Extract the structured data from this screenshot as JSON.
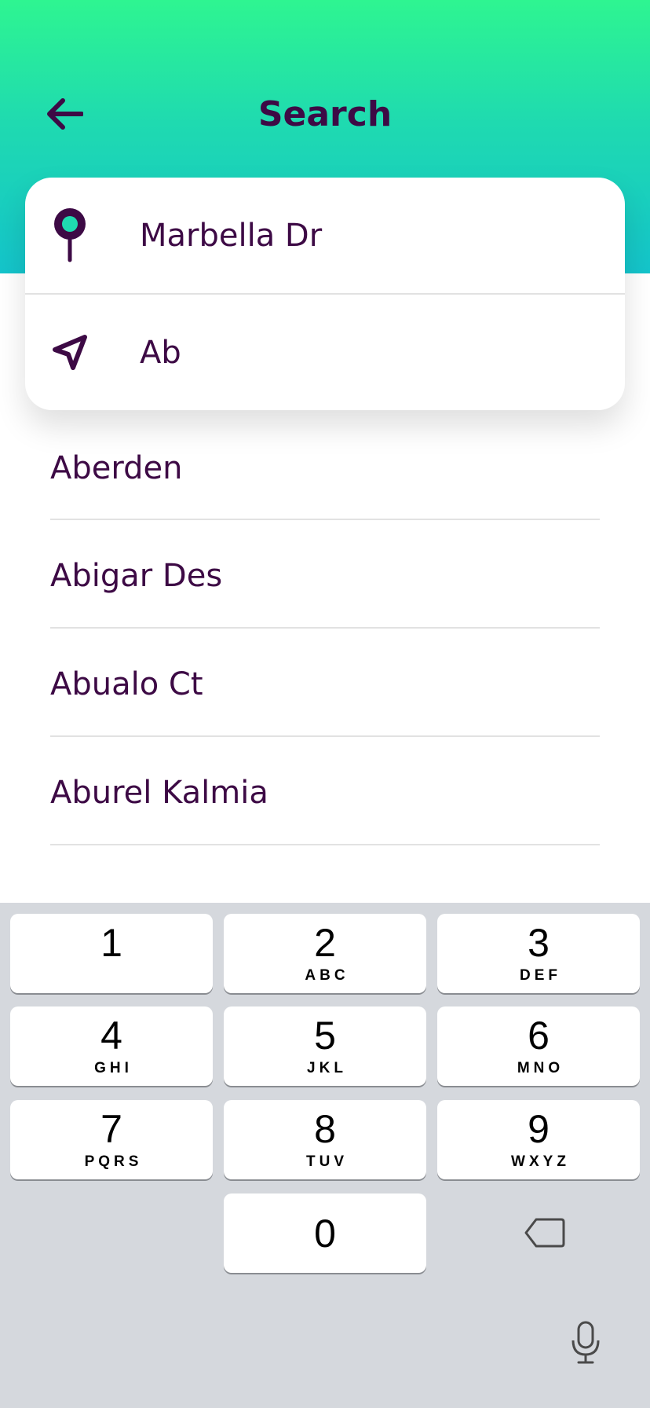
{
  "header": {
    "title": "Search",
    "back_icon": "arrow-left-icon",
    "gradient_top": "#2ef591",
    "gradient_bottom": "#14c4cb"
  },
  "search": {
    "from_icon": "location-pin-icon",
    "from_value": "Marbella Dr",
    "to_icon": "navigation-arrow-icon",
    "to_value": "Ab"
  },
  "suggestions": [
    "Aberden",
    "Abigar Des",
    "Abualo Ct",
    "Aburel Kalmia"
  ],
  "keyboard": {
    "keys": [
      {
        "num": "1",
        "letters": ""
      },
      {
        "num": "2",
        "letters": "ABC"
      },
      {
        "num": "3",
        "letters": "DEF"
      },
      {
        "num": "4",
        "letters": "GHI"
      },
      {
        "num": "5",
        "letters": "JKL"
      },
      {
        "num": "6",
        "letters": "MNO"
      },
      {
        "num": "7",
        "letters": "PQRS"
      },
      {
        "num": "8",
        "letters": "TUV"
      },
      {
        "num": "9",
        "letters": "WXYZ"
      },
      {
        "num": "0",
        "letters": ""
      }
    ],
    "delete_icon": "backspace-icon",
    "mic_icon": "microphone-icon"
  },
  "colors": {
    "text": "#3d0a45",
    "accent": "#1fdab0",
    "keyboard_bg": "#d5d8dd"
  }
}
